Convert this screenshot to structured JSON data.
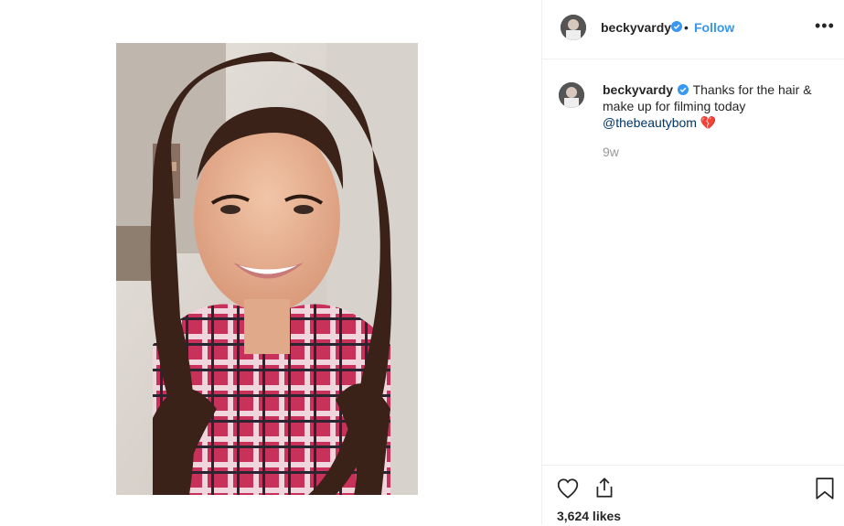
{
  "post": {
    "username": "beckyvardy",
    "follow_label": "Follow",
    "separator": "•",
    "more_label": "•••",
    "caption_text": "Thanks for the hair & make up for filming today",
    "caption_mention": "@thebeautybom",
    "caption_emoji": "💔",
    "time_ago": "9w",
    "likes": "3,624 likes"
  },
  "colors": {
    "link_blue": "#3897f0",
    "mention_blue": "#003569",
    "verified_blue": "#3897f0",
    "muted": "#999999"
  },
  "icons": {
    "verified": "verified-badge-icon",
    "like": "heart-icon",
    "share": "share-icon",
    "save": "bookmark-icon",
    "more": "more-options-icon"
  }
}
